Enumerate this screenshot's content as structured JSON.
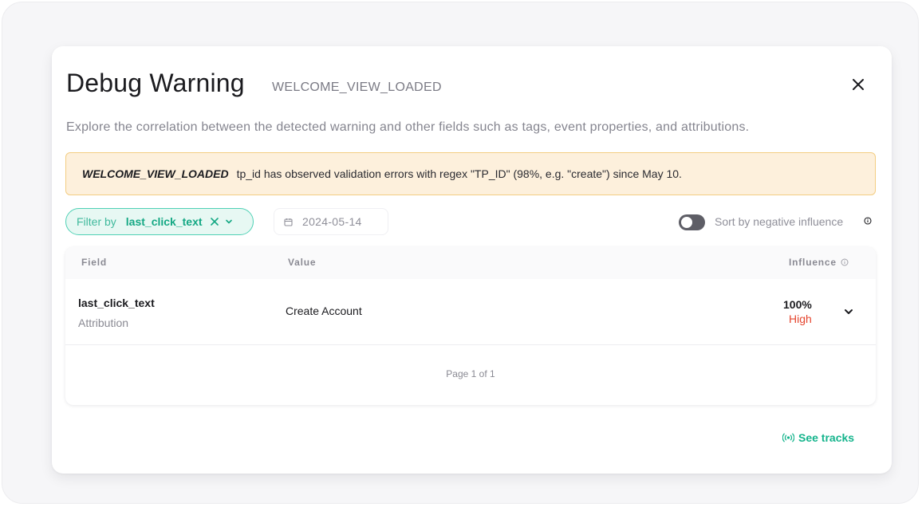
{
  "modal": {
    "title": "Debug Warning",
    "event_name": "WELCOME_VIEW_LOADED",
    "description": "Explore the correlation between the detected warning and other fields such as tags, event properties, and attributions."
  },
  "alert": {
    "event_name": "WELCOME_VIEW_LOADED",
    "message": "tp_id has observed validation errors with regex \"TP_ID\" (98%, e.g. \"create\") since May 10."
  },
  "filters": {
    "filter_prefix": "Filter by",
    "filter_value": "last_click_text",
    "date": "2024-05-14",
    "sort_toggle_label": "Sort by negative influence",
    "sort_toggle_on": false
  },
  "table": {
    "headers": {
      "field": "Field",
      "value": "Value",
      "influence": "Influence"
    },
    "rows": [
      {
        "field_name": "last_click_text",
        "field_type": "Attribution",
        "value": "Create Account",
        "influence_pct": "100%",
        "influence_level": "High"
      }
    ],
    "pagination": "Page 1 of 1"
  },
  "footer": {
    "see_tracks_label": "See tracks"
  },
  "colors": {
    "accent": "#14b48c",
    "warning_bg": "#fdf0dc",
    "warning_border": "#f3cd82",
    "high_influence": "#e5452e"
  },
  "icons": {
    "close": "close-icon",
    "chip_clear": "close-icon",
    "chip_dropdown": "chevron-down-icon",
    "date": "calendar-icon",
    "info": "info-icon",
    "row_expand": "chevron-down-icon",
    "see_tracks": "broadcast-icon"
  }
}
